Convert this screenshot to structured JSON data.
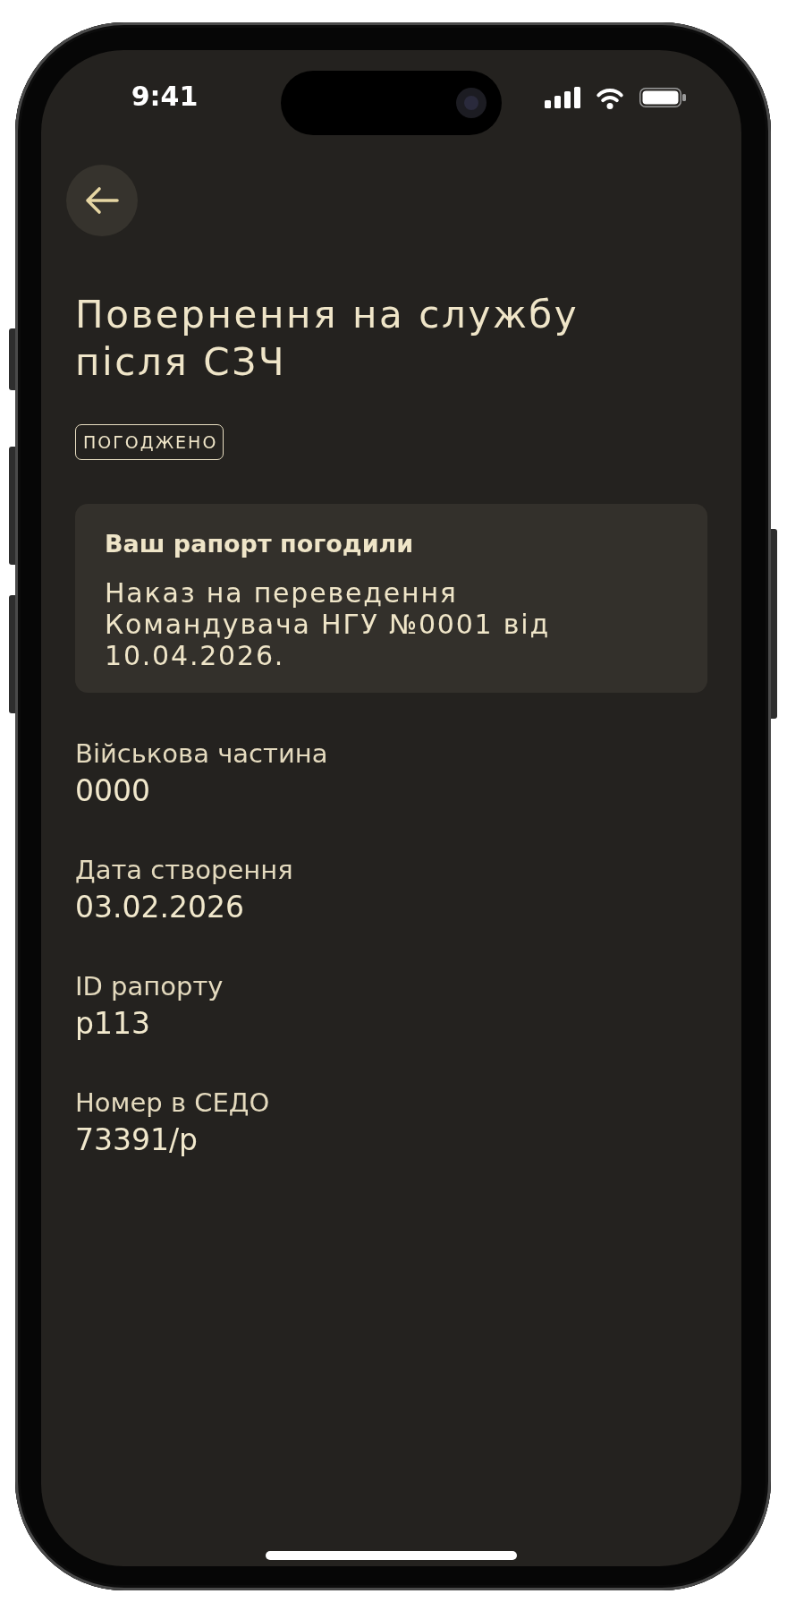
{
  "status_bar": {
    "time": "9:41"
  },
  "title": "Повернення на службу після СЗЧ",
  "status_badge": {
    "label": "ПОГОДЖЕНО"
  },
  "notice": {
    "title": "Ваш рапорт погодили",
    "text": "Наказ на переведення Командувача НГУ №0001 від 10.04.2026."
  },
  "fields": [
    {
      "label": "Військова частина",
      "value": "0000"
    },
    {
      "label": "Дата створення",
      "value": "03.02.2026"
    },
    {
      "label": "ID рапорту",
      "value": "р113"
    },
    {
      "label": "Номер в СЕДО",
      "value": "73391/р"
    }
  ]
}
